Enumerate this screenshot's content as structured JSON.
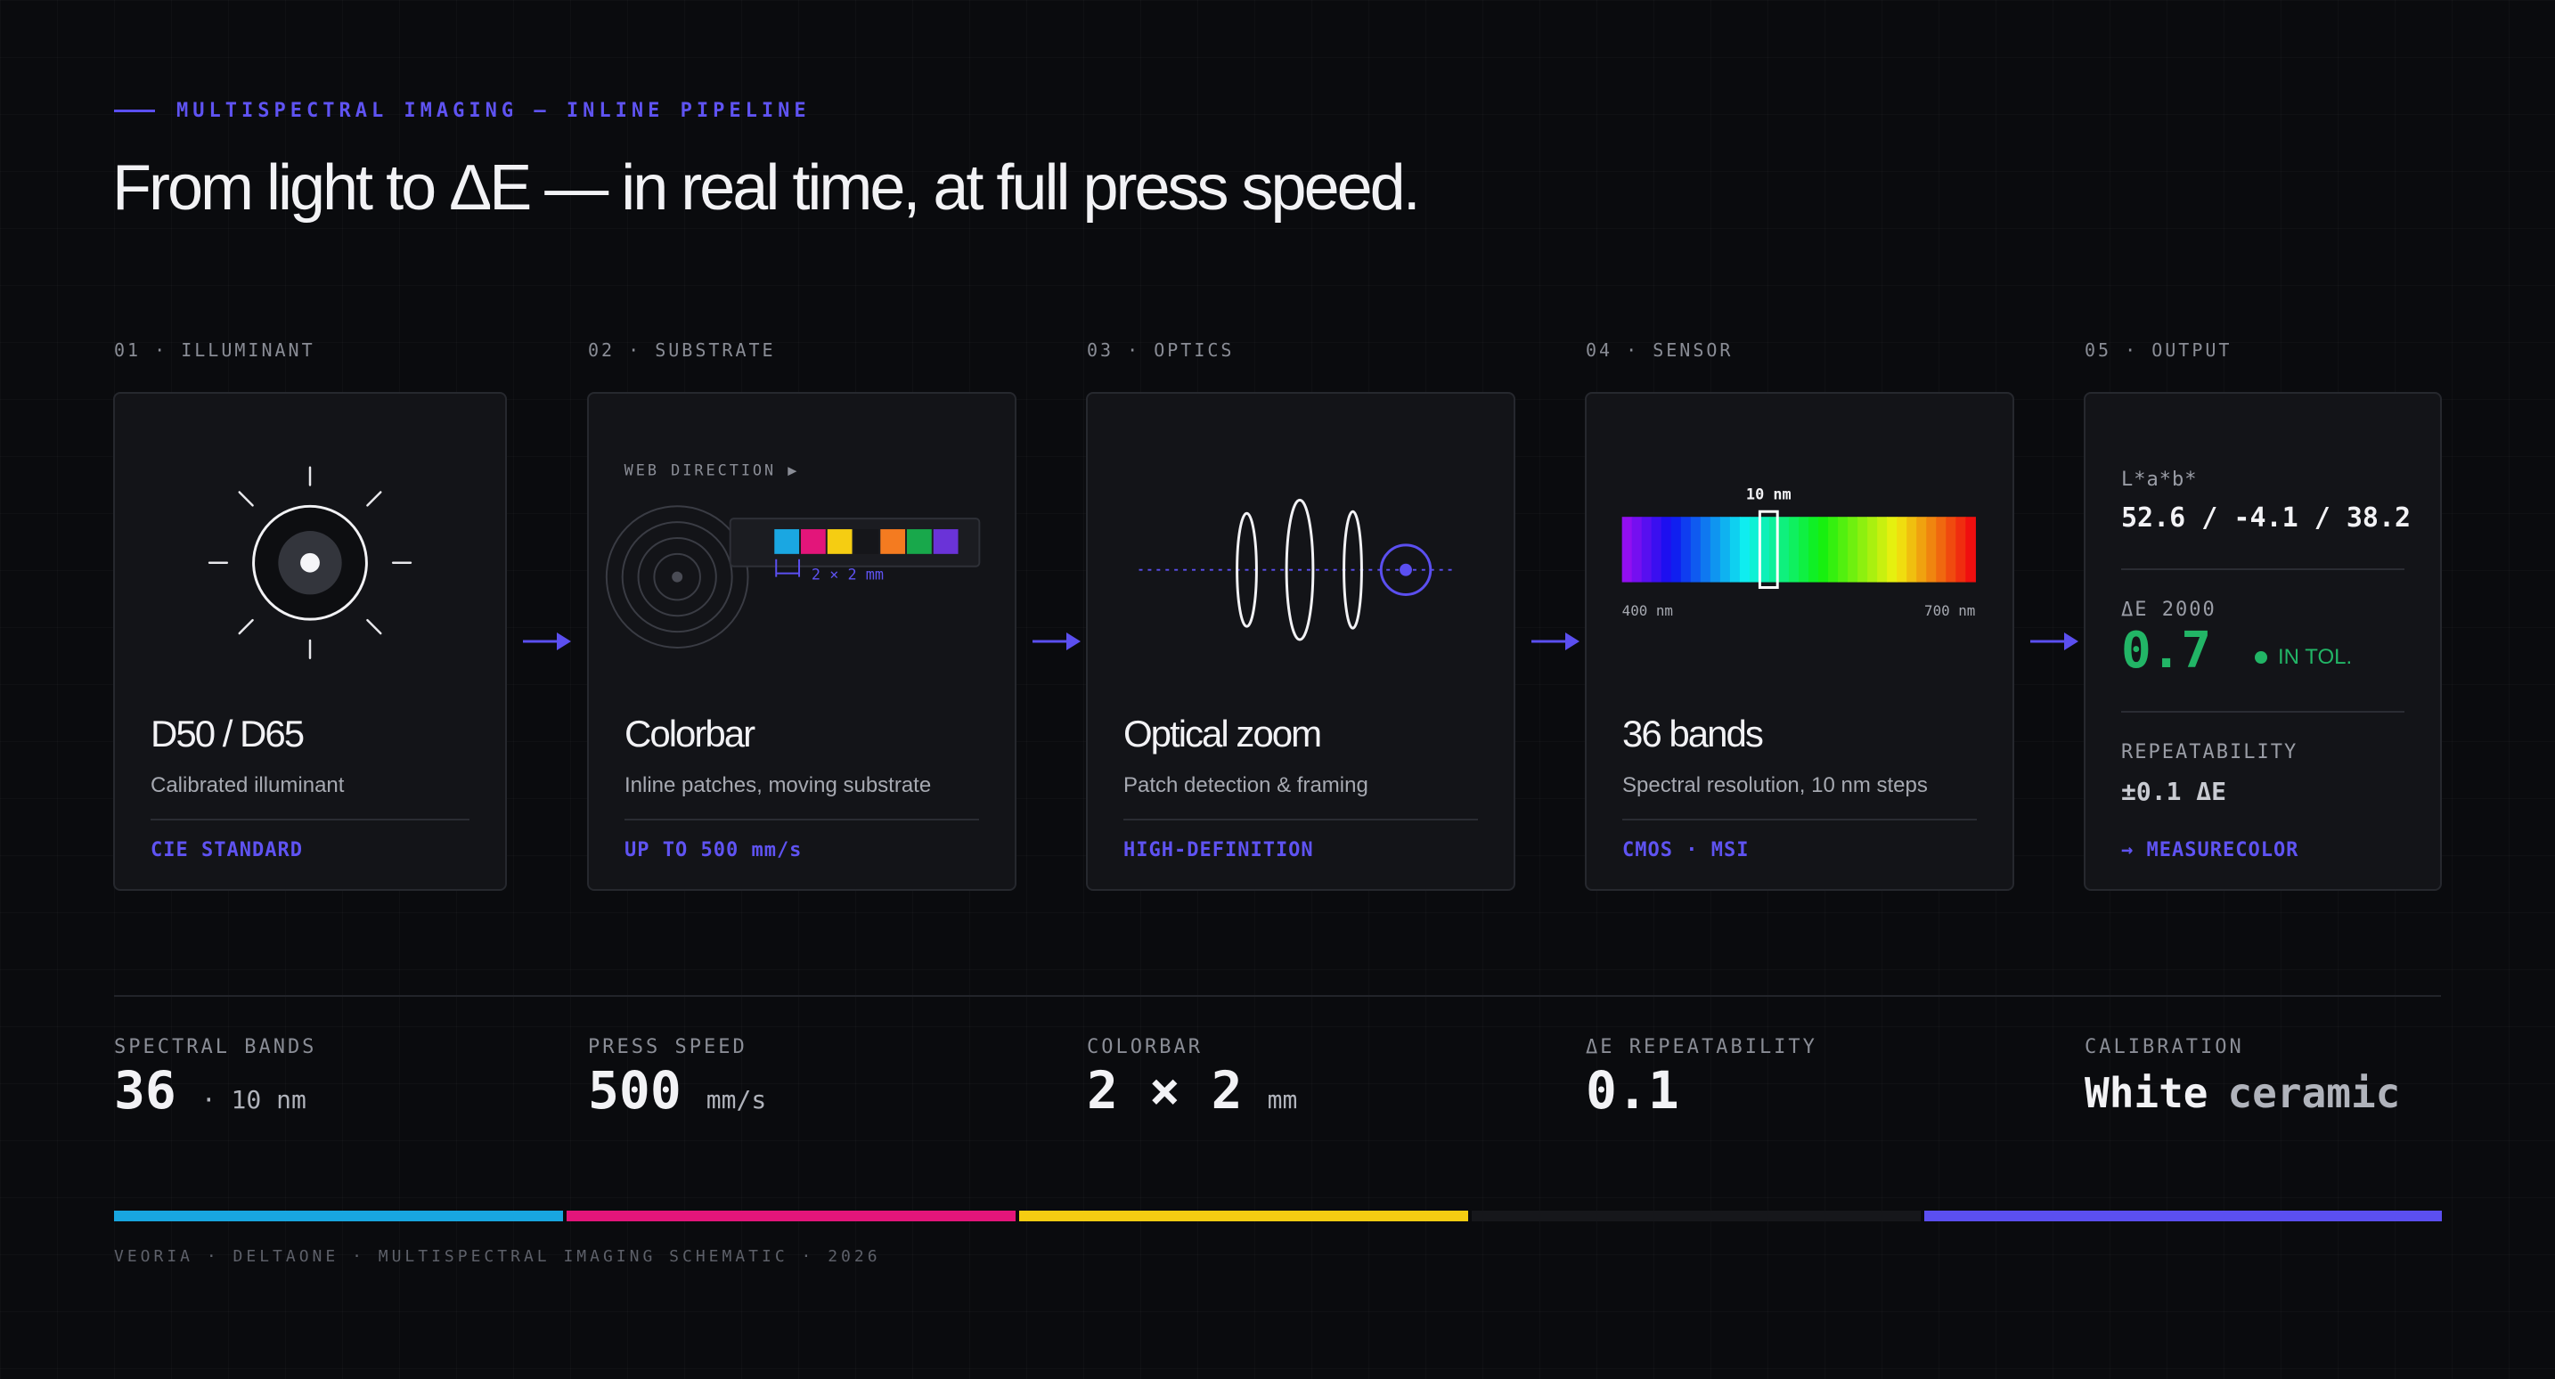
{
  "header": {
    "eyebrow": "MULTISPECTRAL IMAGING — INLINE PIPELINE",
    "title": "From light to ΔE — in real time, at full press speed."
  },
  "steps": [
    {
      "label": "01 · ILLUMINANT",
      "name": "D50 / D65",
      "desc": "Calibrated illuminant",
      "tag": "CIE STANDARD"
    },
    {
      "label": "02 · SUBSTRATE",
      "name": "Colorbar",
      "desc": "Inline patches, moving substrate",
      "tag": "UP TO 500 mm/s",
      "art": {
        "web_direction": "WEB DIRECTION ▶",
        "patch_size": "2 × 2 mm"
      }
    },
    {
      "label": "03 · OPTICS",
      "name": "Optical zoom",
      "desc": "Patch detection & framing",
      "tag": "HIGH-DEFINITION"
    },
    {
      "label": "04 · SENSOR",
      "name": "36 bands",
      "desc": "Spectral resolution, 10 nm steps",
      "tag": "CMOS · MSI",
      "art": {
        "band_width": "10 nm",
        "range_start": "400 nm",
        "range_end": "700 nm",
        "band_count": 36
      }
    },
    {
      "label": "05 · OUTPUT"
    }
  ],
  "output": {
    "lab_label": "L*a*b*",
    "lab_value": "52.6 / -4.1 / 38.2",
    "de_label": "ΔE 2000",
    "de_value": "0.7",
    "status": "IN TOL.",
    "repeat_label": "REPEATABILITY",
    "repeat_value": "±0.1 ΔE",
    "link": "→ MEASURECOLOR"
  },
  "stats": [
    {
      "label": "SPECTRAL BANDS",
      "value": "36",
      "unit": "· 10 nm"
    },
    {
      "label": "PRESS SPEED",
      "value": "500",
      "unit": "mm/s"
    },
    {
      "label": "COLORBAR",
      "value": "2 × 2",
      "unit": "mm"
    },
    {
      "label": "ΔE REPEATABILITY",
      "value": "0.1",
      "unit": ""
    },
    {
      "label": "CALIBRATION",
      "value": "White",
      "value2": "ceramic"
    }
  ],
  "footer": "VEORIA · DELTAONE · MULTISPECTRAL IMAGING SCHEMATIC · 2026",
  "colors": {
    "accent": "#5b4ff0",
    "success": "#22b566",
    "strip": [
      "#18a6e0",
      "#e3157a",
      "#f5cd12",
      "#16171b",
      "#5b4ff0"
    ],
    "patches": [
      "#1aa7e2",
      "#e3157a",
      "#f5cd12",
      "#15161a",
      "#f47b20",
      "#18a84b",
      "#6a33d8"
    ]
  }
}
